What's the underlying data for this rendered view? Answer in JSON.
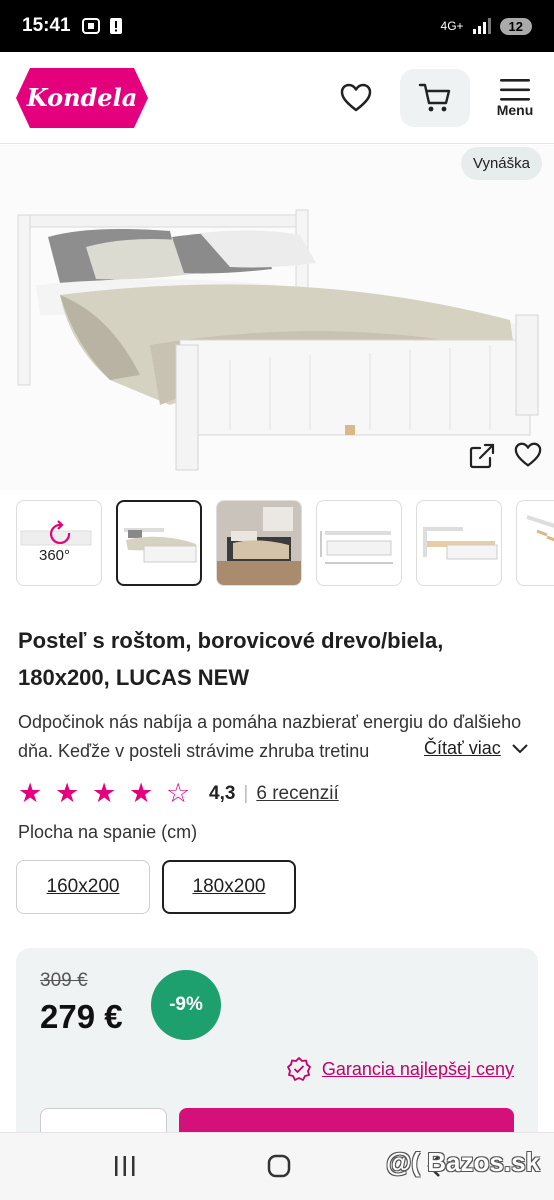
{
  "status_bar": {
    "time": "15:41",
    "network": "4G+",
    "battery": "12"
  },
  "header": {
    "logo_text": "Kondela",
    "menu_label": "Menu",
    "brand_color": "#e4007c"
  },
  "gallery": {
    "badge": "Vynáška",
    "thumb_360_label": "360°"
  },
  "product": {
    "title": "Posteľ s roštom, borovicové drevo/biela, 180x200, LUCAS NEW",
    "description": "Odpočinok nás nabíja a pomáha nazbierať energiu do ďalšieho dňa. Keďže v posteli strávime zhruba tretinu",
    "read_more": "Čítať viac",
    "rating_value": "4,3",
    "rating_stars": 4.3,
    "reviews": "6 recenzií",
    "size_label": "Plocha na spanie (cm)",
    "sizes": [
      "160x200",
      "180x200"
    ],
    "selected_size": "180x200"
  },
  "pricing": {
    "old_price": "309 €",
    "new_price": "279 €",
    "discount": "-9%",
    "guarantee": "Garancia najlepšej ceny",
    "discount_color": "#1e9f6e",
    "cta_color": "#d4117a"
  },
  "watermark": {
    "text": "@( Bazos.sk"
  }
}
